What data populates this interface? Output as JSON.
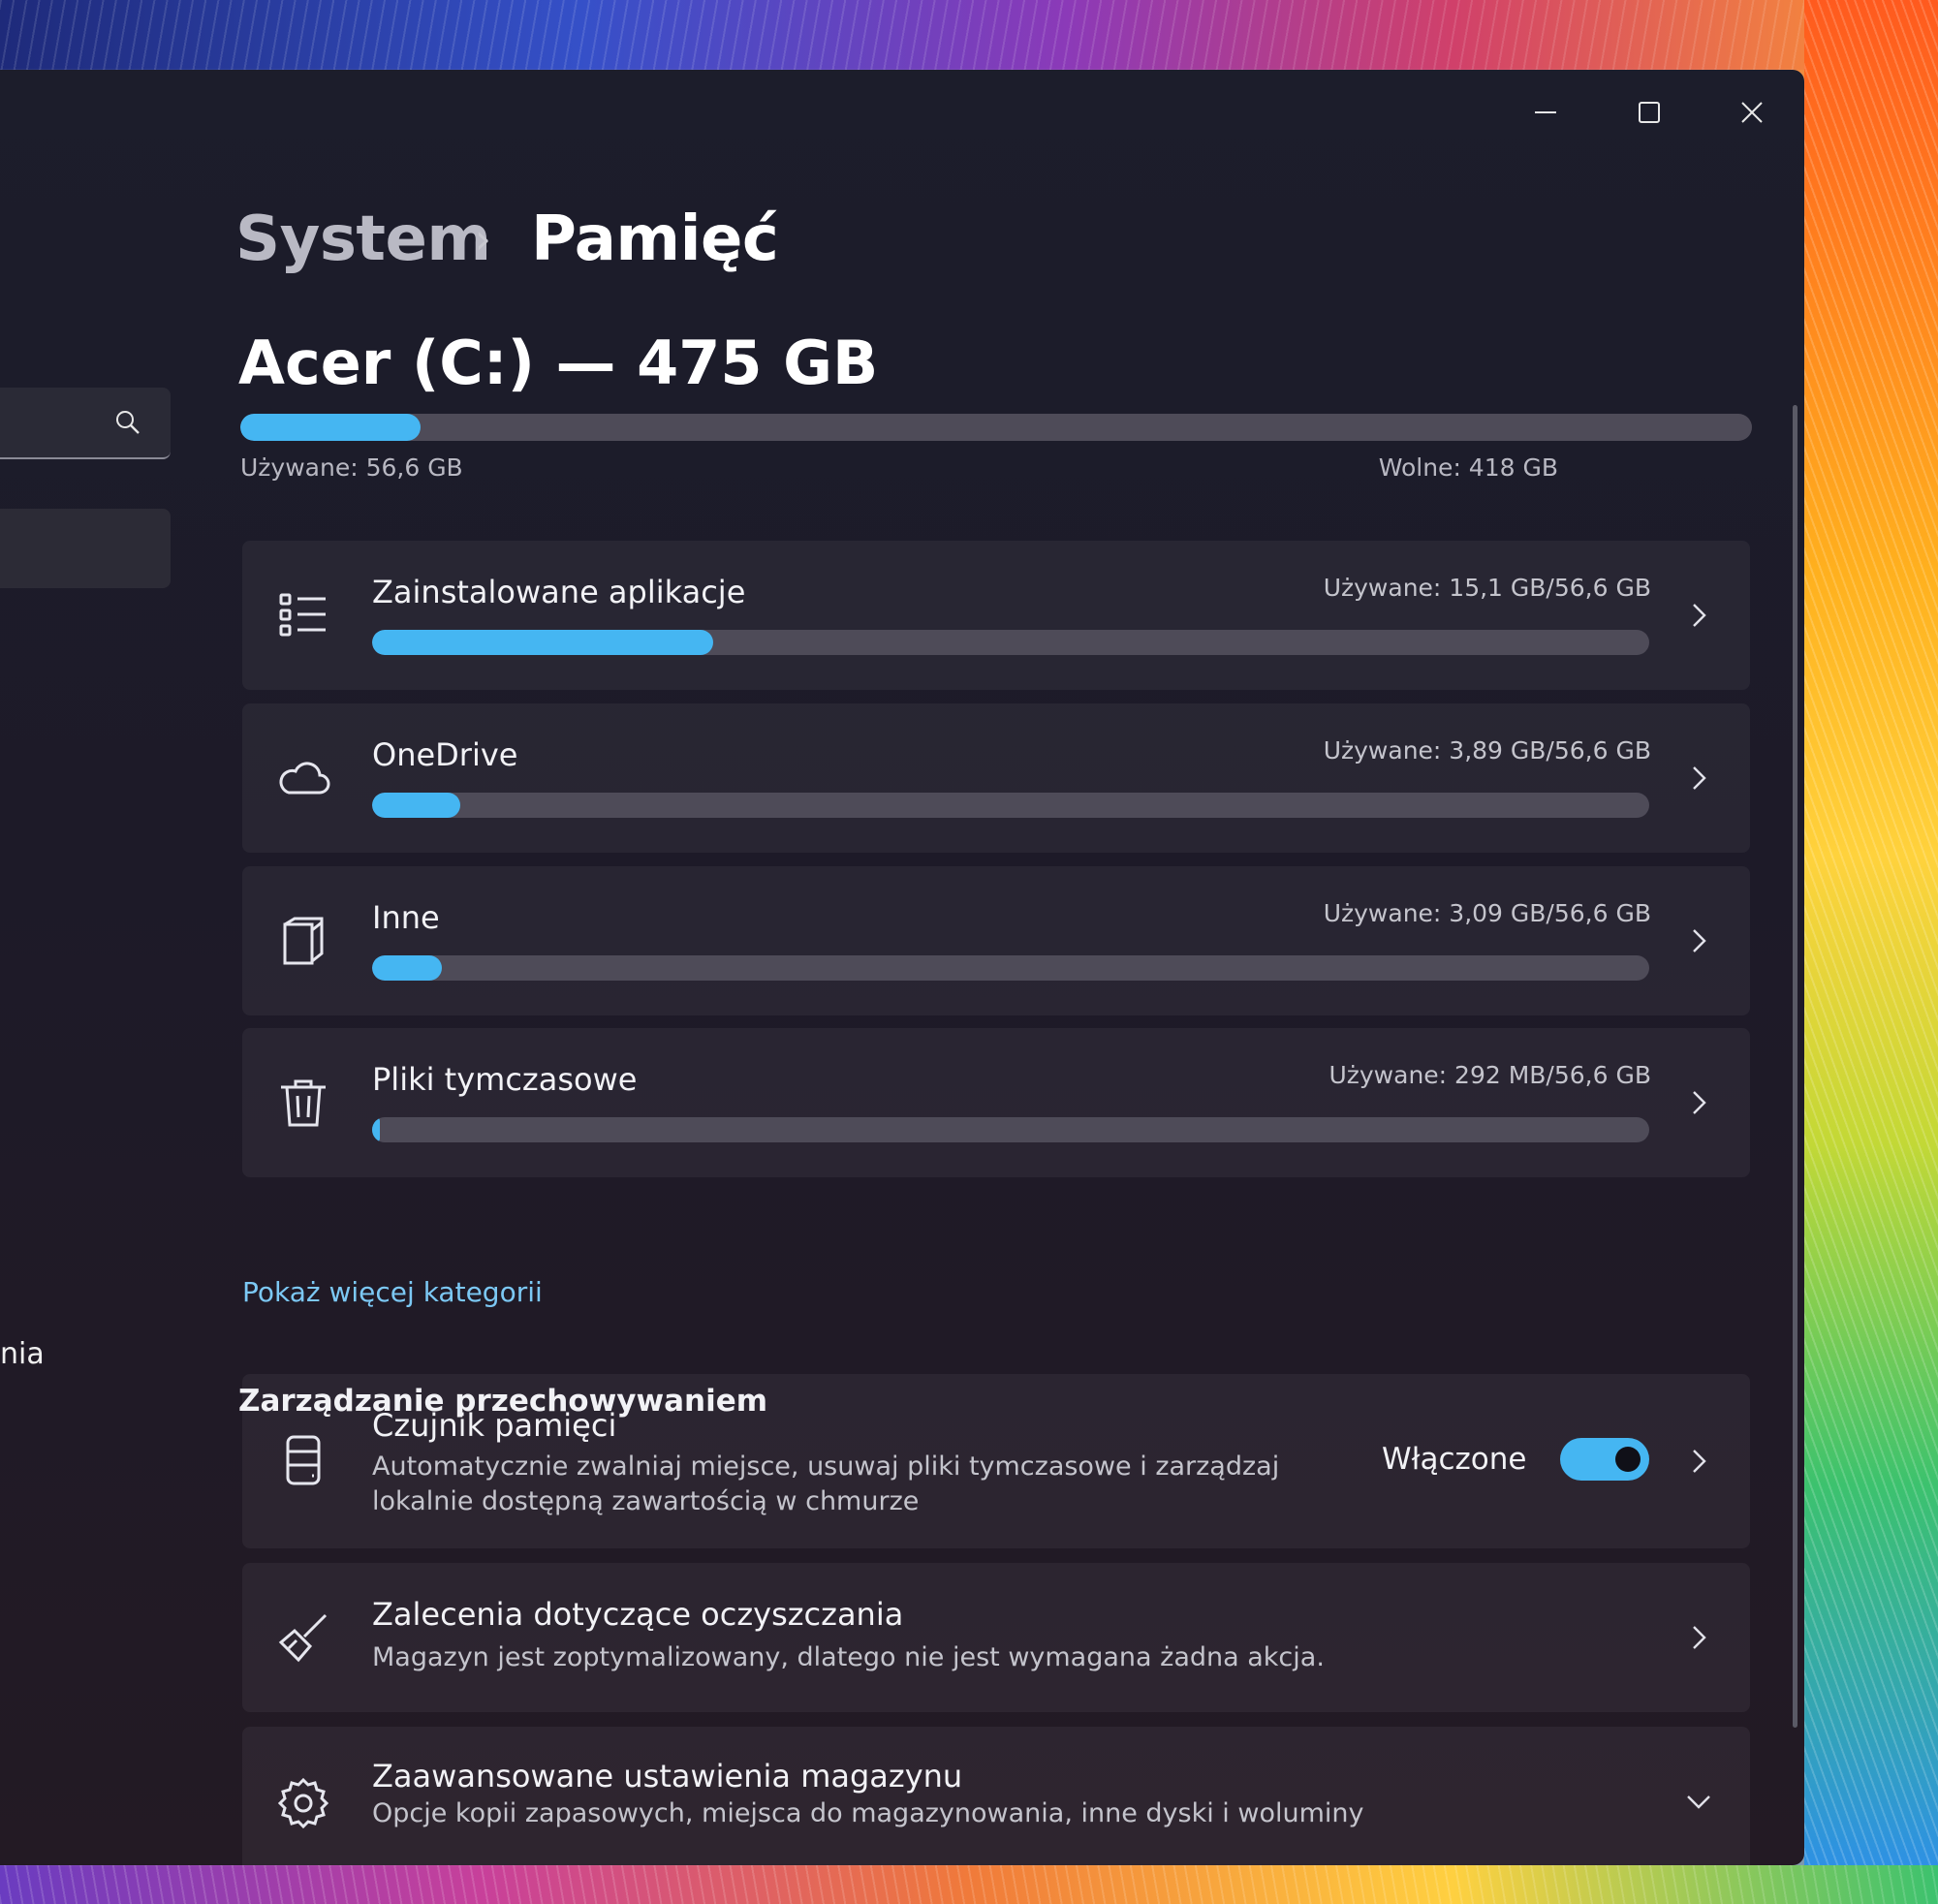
{
  "window": {
    "breadcrumb_parent": "System",
    "breadcrumb_separator": "›",
    "breadcrumb_current": "Pamięć"
  },
  "sidebar": {
    "partial_label": "nia"
  },
  "drive": {
    "title": "Acer (C:) — 475 GB",
    "used_label": "Używane: 56,6 GB",
    "free_label": "Wolne: 418 GB",
    "used_fraction": 0.119
  },
  "categories": [
    {
      "icon": "apps-list-icon",
      "label": "Zainstalowane aplikacje",
      "used": "Używane: 15,1 GB/56,6 GB",
      "fraction": 0.267
    },
    {
      "icon": "cloud-icon",
      "label": "OneDrive",
      "used": "Używane: 3,89 GB/56,6 GB",
      "fraction": 0.069
    },
    {
      "icon": "other-files-icon",
      "label": "Inne",
      "used": "Używane: 3,09 GB/56,6 GB",
      "fraction": 0.055
    },
    {
      "icon": "trash-icon",
      "label": "Pliki tymczasowe",
      "used": "Używane: 292 MB/56,6 GB",
      "fraction": 0.005
    }
  ],
  "show_more": "Pokaż więcej kategorii",
  "management": {
    "heading": "Zarządzanie przechowywaniem",
    "storage_sense": {
      "title": "Czujnik pamięci",
      "desc_line1": "Automatycznie zwalniaj miejsce, usuwaj pliki tymczasowe i zarządzaj",
      "desc_line2": "lokalnie dostępną zawartością w chmurze",
      "state": "Włączone",
      "on": true
    },
    "cleanup": {
      "title": "Zalecenia dotyczące oczyszczania",
      "desc": "Magazyn jest zoptymalizowany, dlatego nie jest wymagana żadna akcja."
    },
    "advanced": {
      "title": "Zaawansowane ustawienia magazynu",
      "desc": "Opcje kopii zapasowych, miejsca do magazynowania, inne dyski i woluminy"
    }
  },
  "colors": {
    "accent": "#45b6f2",
    "link": "#7cc8f4",
    "window_bg": "#1c1d2b"
  }
}
